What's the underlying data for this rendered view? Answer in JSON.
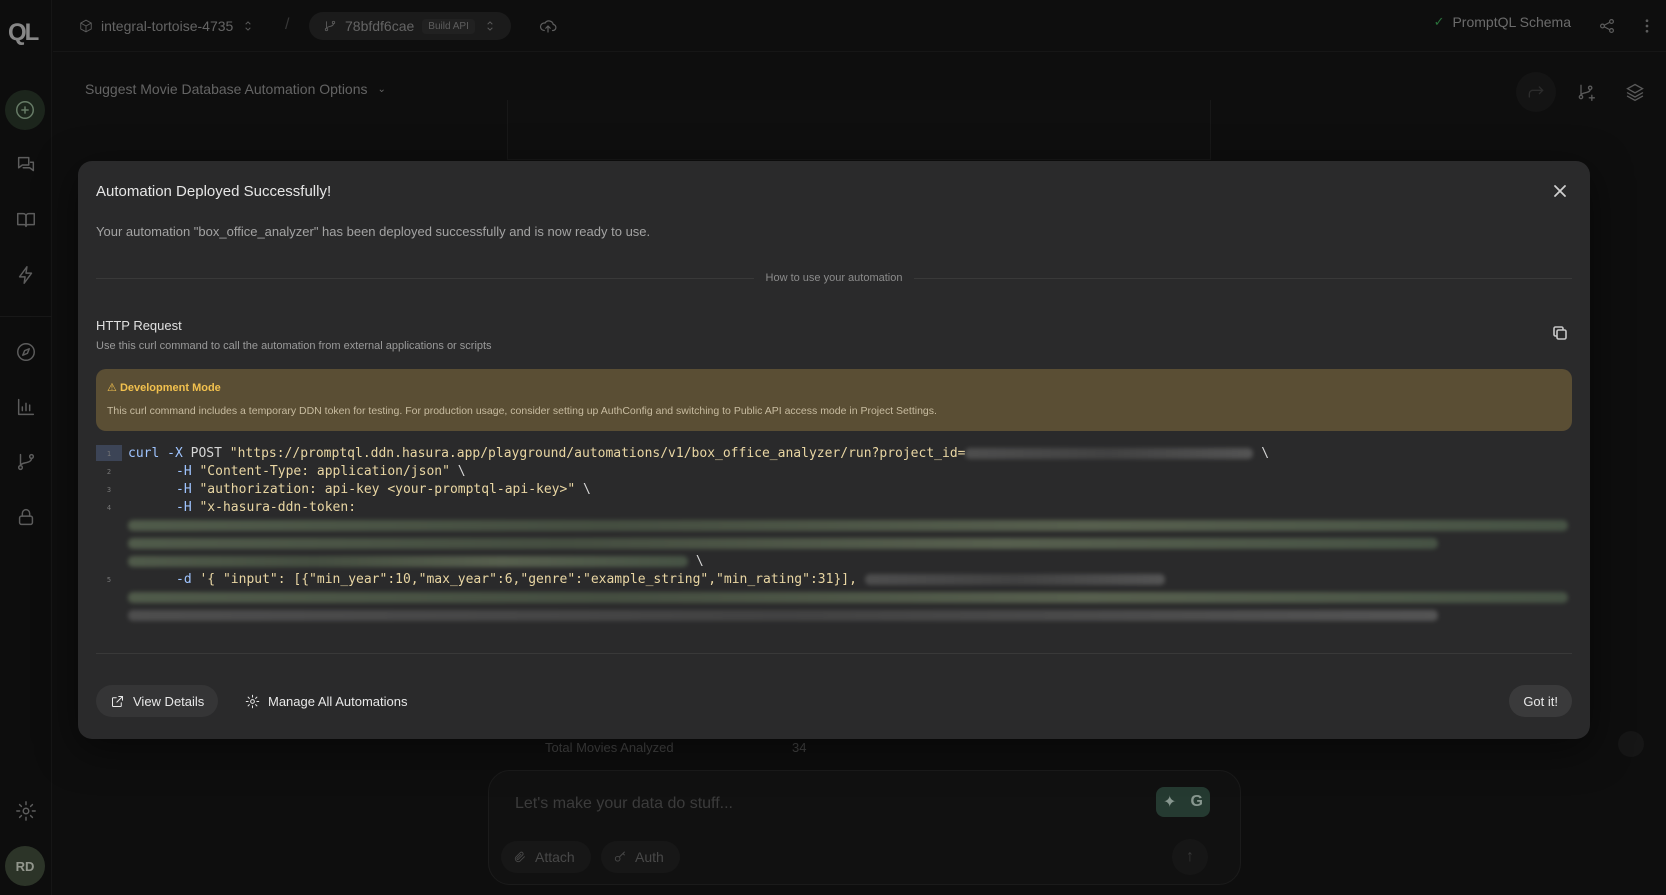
{
  "topbar": {
    "project": "integral-tortoise-4735",
    "separator": "/",
    "build_id": "78bfdf6cae",
    "build_badge": "Build API",
    "schema_label": "PromptQL Schema"
  },
  "sidebar": {
    "logo": "QL",
    "avatar_initials": "RD"
  },
  "workspace": {
    "thread_title": "Suggest Movie Database Automation Options",
    "stat_label": "Total Movies Analyzed",
    "stat_value": "34",
    "chat_placeholder": "Let's make your data do stuff...",
    "attach_label": "Attach",
    "auth_label": "Auth"
  },
  "modal": {
    "title": "Automation Deployed Successfully!",
    "description": "Your automation \"box_office_analyzer\" has been deployed successfully and is now ready to use.",
    "section_label": "How to use your automation",
    "http_title": "HTTP Request",
    "http_subtitle": "Use this curl command to call the automation from external applications or scripts",
    "dev_mode_title": "Development Mode",
    "dev_mode_text": "This curl command includes a temporary DDN token for testing. For production usage, consider setting up AuthConfig and switching to Public API access mode in Project Settings.",
    "code": {
      "line_numbers": [
        "1",
        "2",
        "3",
        "4",
        "5"
      ],
      "l1_cmd": "curl",
      "l1_flag": " -X ",
      "l1_method": "POST ",
      "l1_url": "\"https://promptql.ddn.hasura.app/playground/automations/v1/box_office_analyzer/run?project_id=",
      "line_cont": " \\",
      "l2_flag": "-H ",
      "l2_str": "\"Content-Type: application/json\"",
      "l3_flag": "-H ",
      "l3_str": "\"authorization: api-key <your-promptql-api-key>\"",
      "l4_flag": "-H ",
      "l4_str": "\"x-hasura-ddn-token:",
      "l5_flag": "-d ",
      "l5_str": "'{ \"input\": [{\"min_year\":10,\"max_year\":6,\"genre\":\"example_string\",\"min_rating\":31}],"
    },
    "view_details_label": "View Details",
    "manage_label": "Manage All Automations",
    "got_it_label": "Got it!"
  },
  "icons": {
    "project": "cube-icon",
    "branch": "git-branch-icon",
    "deploy": "cloud-upload-icon",
    "check": "check-icon",
    "share": "share-icon",
    "more": "more-vertical-icon",
    "close": "close-icon",
    "copy": "copy-icon",
    "warning": "warning-icon",
    "external": "external-link-icon",
    "gear": "gear-icon"
  },
  "colors": {
    "warning_accent": "#f2c14e",
    "success": "#3fae5a",
    "dev_banner": "#5a4e34"
  }
}
